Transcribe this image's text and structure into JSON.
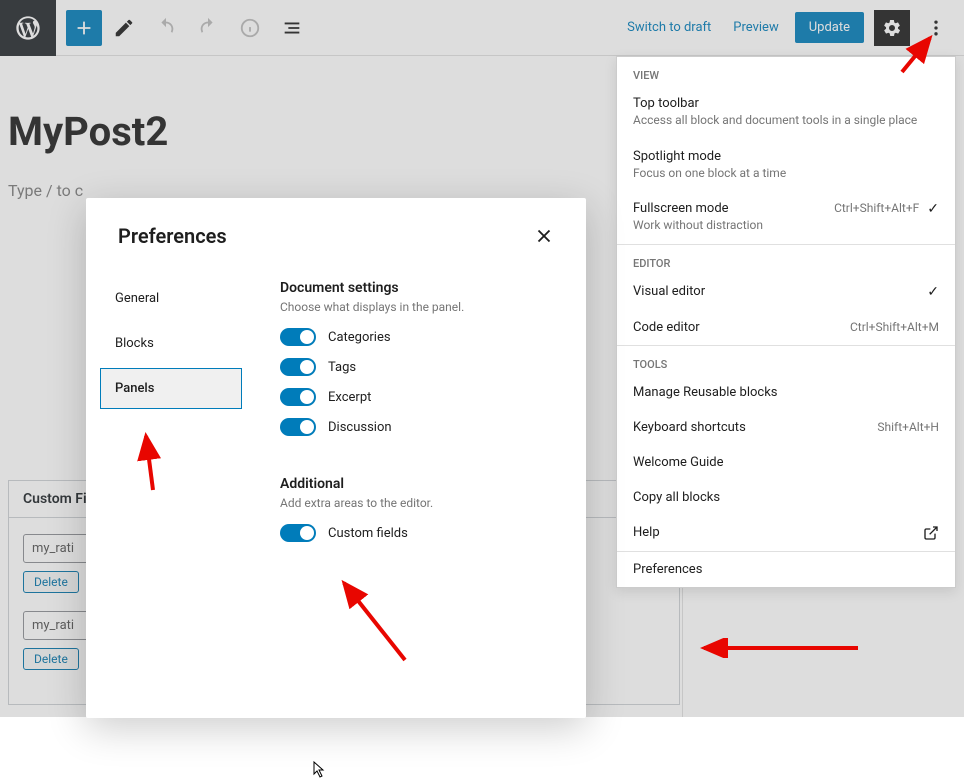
{
  "toolbar": {
    "switch_to_draft": "Switch to draft",
    "preview": "Preview",
    "update": "Update"
  },
  "editor": {
    "title": "MyPost2",
    "placeholder": "Type / to c"
  },
  "custom_fields": {
    "header": "Custom Fi",
    "rows": [
      {
        "name": "my_rati",
        "delete_label": "Delete"
      },
      {
        "name": "my_rati",
        "delete_label": "Delete"
      }
    ]
  },
  "options_menu": {
    "view_label": "VIEW",
    "top_toolbar": {
      "title": "Top toolbar",
      "desc": "Access all block and document tools in a single place"
    },
    "spotlight": {
      "title": "Spotlight mode",
      "desc": "Focus on one block at a time"
    },
    "fullscreen": {
      "title": "Fullscreen mode",
      "desc": "Work without distraction",
      "shortcut": "Ctrl+Shift+Alt+F",
      "checked": true
    },
    "editor_label": "EDITOR",
    "visual_editor": {
      "title": "Visual editor",
      "checked": true
    },
    "code_editor": {
      "title": "Code editor",
      "shortcut": "Ctrl+Shift+Alt+M"
    },
    "tools_label": "TOOLS",
    "manage_reusable": "Manage Reusable blocks",
    "keyboard_shortcuts": {
      "title": "Keyboard shortcuts",
      "shortcut": "Shift+Alt+H"
    },
    "welcome_guide": "Welcome Guide",
    "copy_all": "Copy all blocks",
    "help": "Help",
    "preferences": "Preferences"
  },
  "modal": {
    "title": "Preferences",
    "tabs": {
      "general": "General",
      "blocks": "Blocks",
      "panels": "Panels"
    },
    "doc": {
      "title": "Document settings",
      "desc": "Choose what displays in the panel.",
      "categories": "Categories",
      "tags": "Tags",
      "excerpt": "Excerpt",
      "discussion": "Discussion"
    },
    "additional": {
      "title": "Additional",
      "desc": "Add extra areas to the editor.",
      "custom_fields": "Custom fields"
    }
  }
}
